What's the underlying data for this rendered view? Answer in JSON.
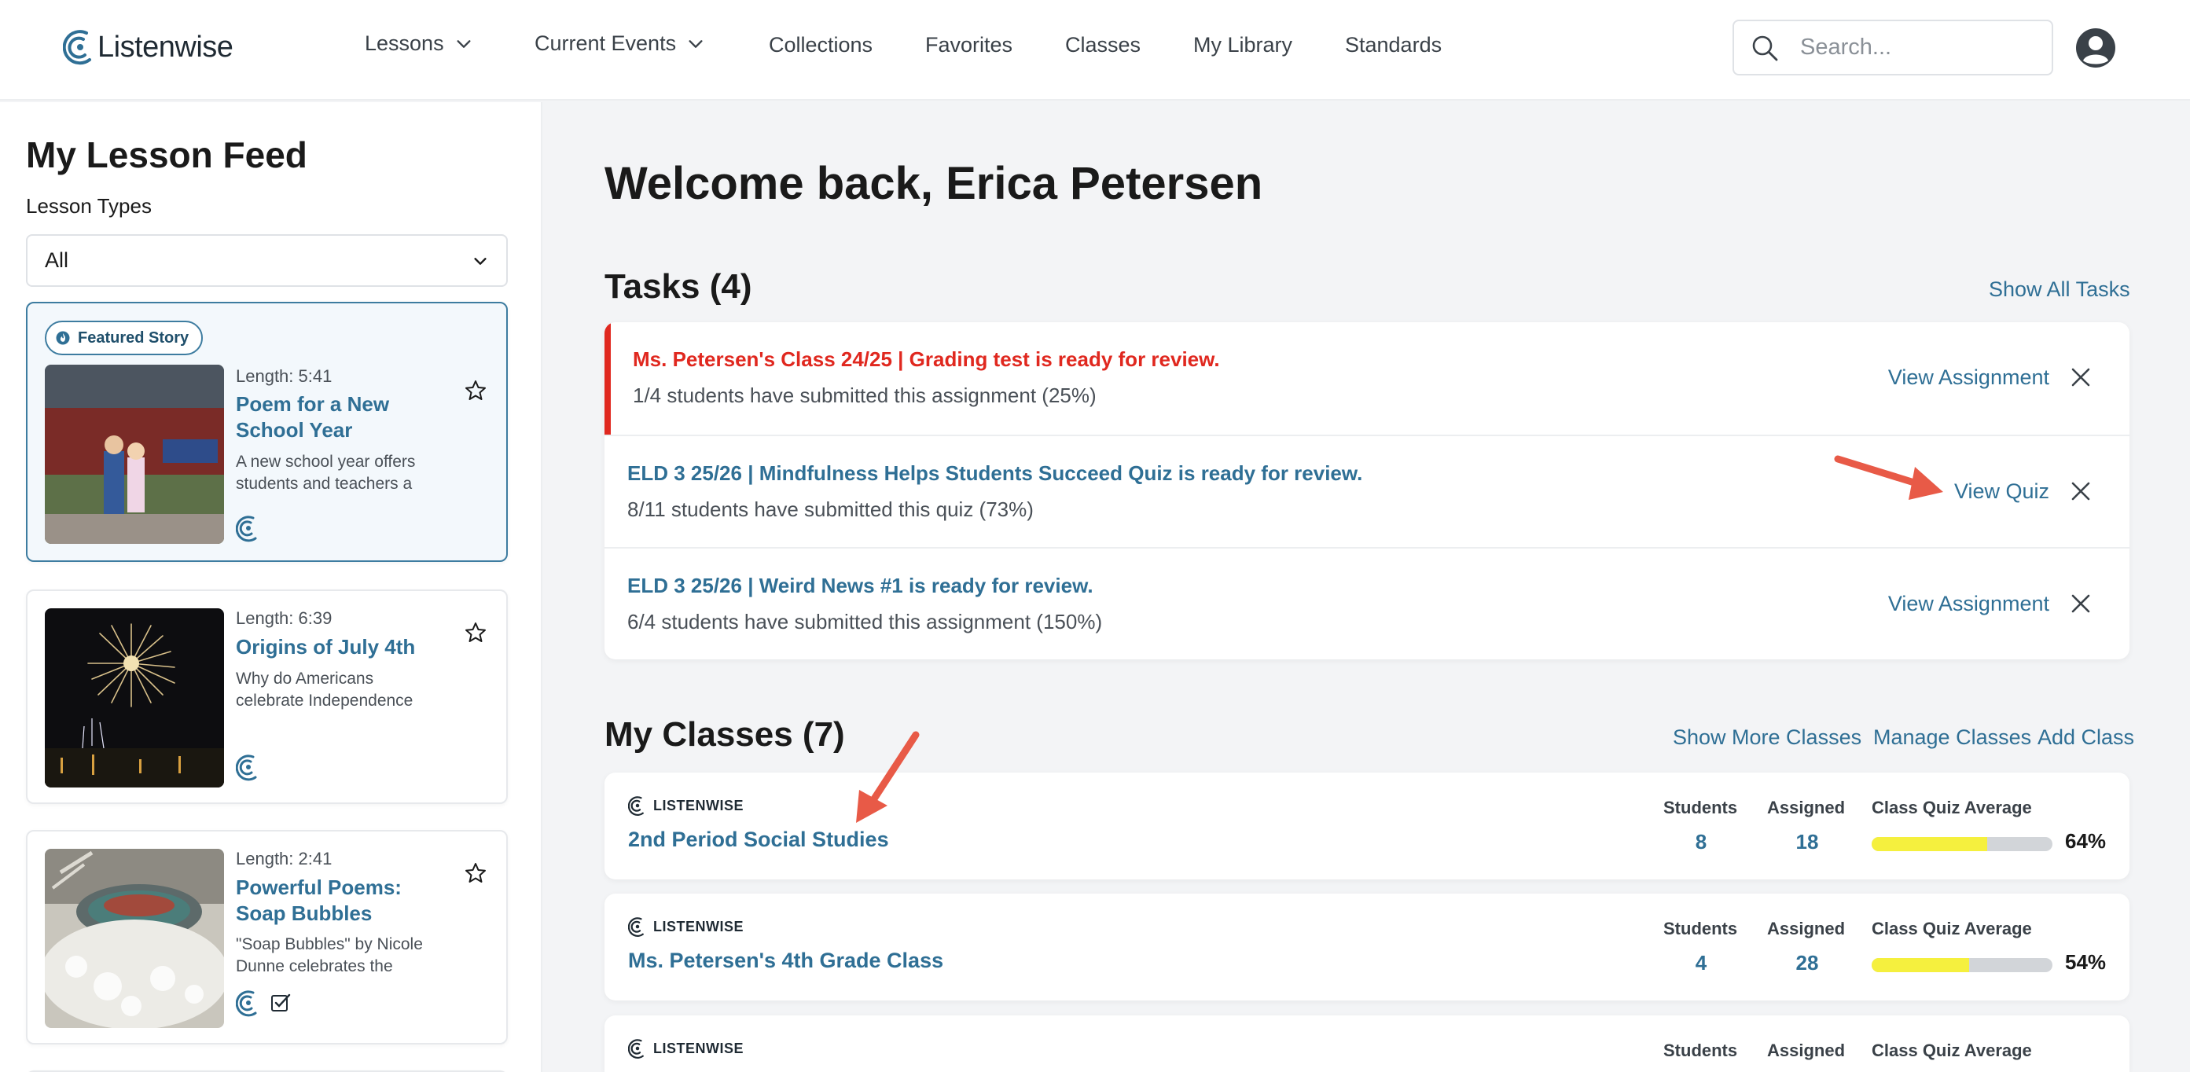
{
  "brand": {
    "name": "Listenwise",
    "accent": "#2f6f95"
  },
  "nav": {
    "lessons": "Lessons",
    "current_events": "Current Events",
    "collections": "Collections",
    "favorites": "Favorites",
    "classes": "Classes",
    "my_library": "My Library",
    "standards": "Standards"
  },
  "search": {
    "placeholder": "Search..."
  },
  "sidebar": {
    "title": "My Lesson Feed",
    "types_label": "Lesson Types",
    "types_selected": "All",
    "featured_badge": "Featured Story",
    "lessons": [
      {
        "length": "Length: 5:41",
        "title": "Poem for a New School Year",
        "desc": "A new school year offers students and teachers a"
      },
      {
        "length": "Length: 6:39",
        "title": "Origins of July 4th",
        "desc": "Why do Americans celebrate Independence"
      },
      {
        "length": "Length: 2:41",
        "title": "Powerful Poems: Soap Bubbles",
        "desc": "\"Soap Bubbles\" by Nicole Dunne celebrates the"
      }
    ]
  },
  "main": {
    "welcome": "Welcome back, Erica Petersen",
    "tasks_title": "Tasks (4)",
    "show_all_tasks": "Show All Tasks",
    "tasks": [
      {
        "title": "Ms. Petersen's Class 24/25 | Grading test is ready for review.",
        "sub": "1/4 students have submitted this assignment (25%)",
        "action": "View Assignment"
      },
      {
        "title": "ELD 3 25/26 | Mindfulness Helps Students Succeed Quiz is ready for review.",
        "sub": "8/11 students have submitted this quiz (73%)",
        "action": "View Quiz"
      },
      {
        "title": "ELD 3 25/26 | Weird News #1 is ready for review.",
        "sub": "6/4 students have submitted this assignment (150%)",
        "action": "View Assignment"
      }
    ],
    "classes_title": "My Classes (7)",
    "show_more_classes": "Show More Classes",
    "manage_classes": "Manage Classes",
    "add_class": "Add Class",
    "class_brand": "LISTENWISE",
    "labels": {
      "students": "Students",
      "assigned": "Assigned",
      "quiz_avg": "Class Quiz Average"
    },
    "classes": [
      {
        "name": "2nd Period Social Studies",
        "students": "8",
        "assigned": "18",
        "avg": "64%",
        "avg_value": 64
      },
      {
        "name": "Ms. Petersen's 4th Grade Class",
        "students": "4",
        "assigned": "28",
        "avg": "54%",
        "avg_value": 54
      },
      {
        "name": "",
        "students": "",
        "assigned": "",
        "avg": "",
        "avg_value": 0
      }
    ]
  },
  "colors": {
    "urgent": "#e0281f",
    "link": "#2f6f95",
    "bar_fill": "#f5f03e",
    "bar_track": "#d2d5d9",
    "annotation_arrow": "#e85a47"
  }
}
